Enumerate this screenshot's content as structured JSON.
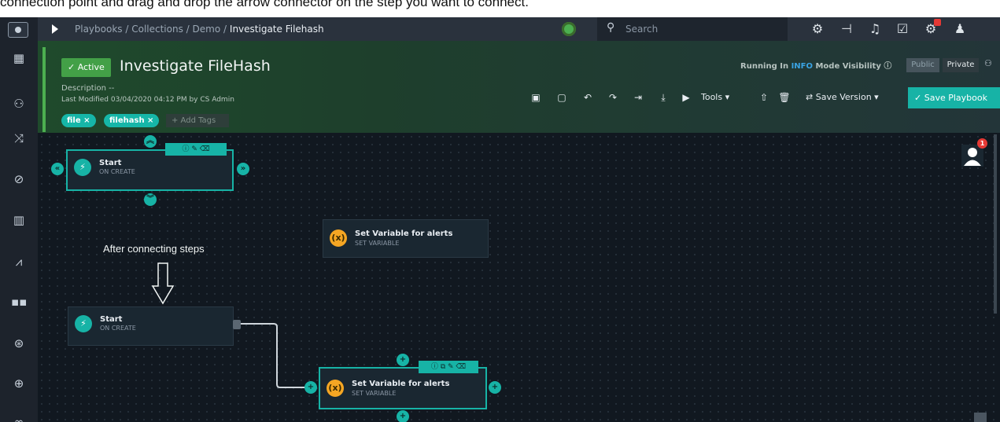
{
  "caption": {
    "text": "connection point and drag and drop the arrow connector on the step you want to connect."
  },
  "header": {
    "breadcrumb": {
      "items": [
        "Playbooks",
        "Collections",
        "Demo"
      ],
      "separator": "/",
      "current": "Investigate Filehash"
    },
    "search_placeholder": "Search",
    "icons": [
      "settings-icon",
      "workflow-icon",
      "bell-icon",
      "clipboard-icon",
      "admin-alert-icon",
      "user-icon"
    ]
  },
  "playbook": {
    "status_label": "Active",
    "title": "Investigate FileHash",
    "description": "Description --",
    "last_modified": "Last Modified 03/04/2020 04:12 PM by CS Admin",
    "tags": [
      "file",
      "filehash"
    ],
    "add_tags_placeholder": "+ Add Tags",
    "running_prefix": "Running In",
    "running_mode": "INFO",
    "running_suffix": "Mode",
    "visibility_label": "Visibility",
    "visibility_options": [
      "Public",
      "Private"
    ],
    "toolbar": {
      "tools_label": "Tools",
      "save_version_label": "Save Version",
      "save_playbook_label": "Save Playbook"
    }
  },
  "canvas": {
    "annotation": "After connecting steps",
    "nodes": [
      {
        "title": "Start",
        "subtitle": "ON CREATE"
      },
      {
        "title": "Set Variable for alerts",
        "subtitle": "SET VARIABLE"
      },
      {
        "title": "Start",
        "subtitle": "ON CREATE"
      },
      {
        "title": "Set Variable for alerts",
        "subtitle": "SET VARIABLE"
      }
    ],
    "notification_count": "1"
  },
  "colors": {
    "accent_teal": "#17b3a6",
    "active_green": "#43a047",
    "variable_orange": "#f5a623",
    "canvas_bg": "#111820"
  }
}
